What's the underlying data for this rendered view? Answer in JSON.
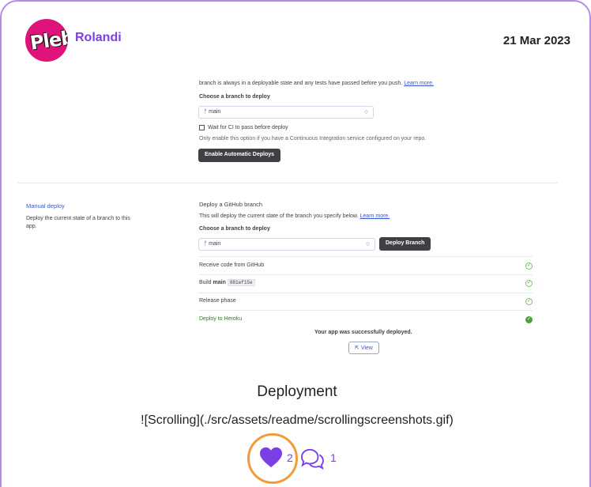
{
  "post": {
    "author": "Rolandi",
    "avatar_text": "Pleb",
    "date": "21 Mar 2023",
    "heading": "Deployment",
    "markdown_line": "![Scrolling](./src/assets/readme/scrollingscreenshots.gif)",
    "likes": "2",
    "comments": "1"
  },
  "screenshot": {
    "auto_deploy": {
      "intro_text": "branch is always in a deployable state and any tests have passed before you push.",
      "intro_link": "Learn more.",
      "choose_label": "Choose a branch to deploy",
      "branch": "main",
      "ci_checkbox_label": "Wait for CI to pass before deploy",
      "ci_hint": "Only enable this option if you have a Continuous Integration service configured on your repo.",
      "enable_button": "Enable Automatic Deploys"
    },
    "manual_deploy": {
      "title": "Manual deploy",
      "description_line1": "Deploy the current state of a branch to this",
      "description_line2": "app.",
      "section_heading": "Deploy a GitHub branch",
      "info_text": "This will deploy the current state of the branch you specify below.",
      "info_link": "Learn more.",
      "choose_label": "Choose a branch to deploy",
      "branch": "main",
      "deploy_button": "Deploy Branch",
      "steps": [
        {
          "label": "Receive code from GitHub"
        },
        {
          "label_prefix": "Build",
          "label_branch": "main",
          "label_commit": "881ef15e"
        },
        {
          "label": "Release phase"
        },
        {
          "label": "Deploy to Heroku"
        }
      ],
      "success_message": "Your app was successfully deployed.",
      "view_button": "View"
    }
  },
  "colors": {
    "accent": "#7b3fe4",
    "card_border": "#b48be8",
    "like_ring": "#f39a3b",
    "success_green": "#4ea23b"
  }
}
